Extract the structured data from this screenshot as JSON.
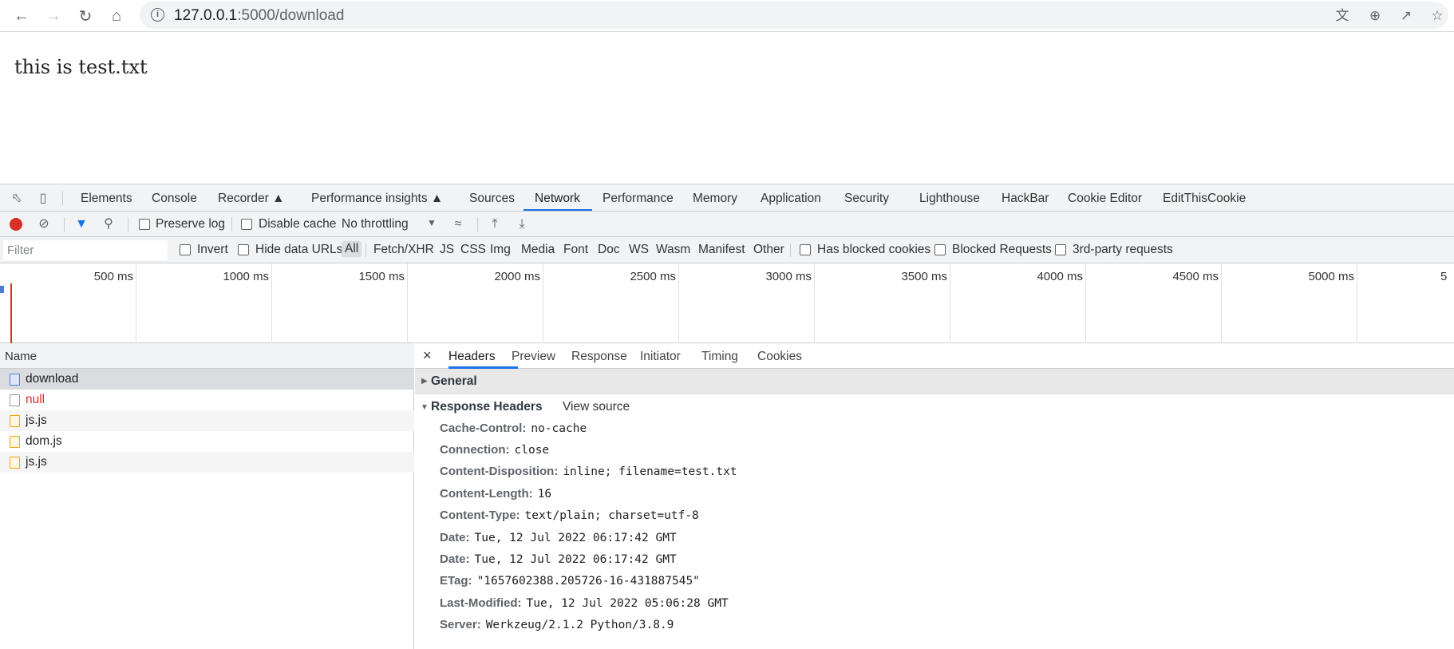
{
  "browser": {
    "url_host": "127.0.0.1",
    "url_path": ":5000/download"
  },
  "page": {
    "body_text": "this is test.txt"
  },
  "devtools": {
    "tabs": [
      "Elements",
      "Console",
      "Recorder",
      "Performance insights",
      "Sources",
      "Network",
      "Performance",
      "Memory",
      "Application",
      "Security",
      "Lighthouse",
      "HackBar",
      "Cookie Editor",
      "EditThisCookie"
    ],
    "active_tab": "Network",
    "toolbar": {
      "preserve_log": "Preserve log",
      "disable_cache": "Disable cache",
      "throttling": "No throttling"
    },
    "filter": {
      "placeholder": "Filter",
      "invert": "Invert",
      "hide_data_urls": "Hide data URLs",
      "types": [
        "All",
        "Fetch/XHR",
        "JS",
        "CSS",
        "Img",
        "Media",
        "Font",
        "Doc",
        "WS",
        "Wasm",
        "Manifest",
        "Other"
      ],
      "has_blocked_cookies": "Has blocked cookies",
      "blocked_requests": "Blocked Requests",
      "third_party": "3rd-party requests"
    },
    "timeline": {
      "labels": [
        "500 ms",
        "1000 ms",
        "1500 ms",
        "2000 ms",
        "2500 ms",
        "3000 ms",
        "3500 ms",
        "4000 ms",
        "4500 ms",
        "5000 ms",
        "5"
      ]
    },
    "requests": {
      "header": "Name",
      "rows": [
        {
          "name": "download",
          "type": "doc",
          "color": "#202124"
        },
        {
          "name": "null",
          "type": "doc",
          "color": "#d93025"
        },
        {
          "name": "js.js",
          "type": "script",
          "color": "#202124"
        },
        {
          "name": "dom.js",
          "type": "script",
          "color": "#202124"
        },
        {
          "name": "js.js",
          "type": "script",
          "color": "#202124"
        }
      ]
    },
    "detail": {
      "tabs": [
        "Headers",
        "Preview",
        "Response",
        "Initiator",
        "Timing",
        "Cookies"
      ],
      "active_tab": "Headers",
      "general": "General",
      "response_headers_title": "Response Headers",
      "view_source": "View source",
      "headers": [
        {
          "key": "Cache-Control:",
          "value": "no-cache"
        },
        {
          "key": "Connection:",
          "value": "close"
        },
        {
          "key": "Content-Disposition:",
          "value": "inline; filename=test.txt"
        },
        {
          "key": "Content-Length:",
          "value": "16"
        },
        {
          "key": "Content-Type:",
          "value": "text/plain; charset=utf-8"
        },
        {
          "key": "Date:",
          "value": "Tue, 12 Jul 2022 06:17:42 GMT"
        },
        {
          "key": "Date:",
          "value": "Tue, 12 Jul 2022 06:17:42 GMT"
        },
        {
          "key": "ETag:",
          "value": "\"1657602388.205726-16-431887545\""
        },
        {
          "key": "Last-Modified:",
          "value": "Tue, 12 Jul 2022 05:06:28 GMT"
        },
        {
          "key": "Server:",
          "value": "Werkzeug/2.1.2 Python/3.8.9"
        }
      ]
    }
  },
  "colors": {
    "accent": "#1a73e8",
    "record": "#d93025",
    "script_icon": "#f2a600",
    "doc_icon": "#4a7fd6"
  }
}
